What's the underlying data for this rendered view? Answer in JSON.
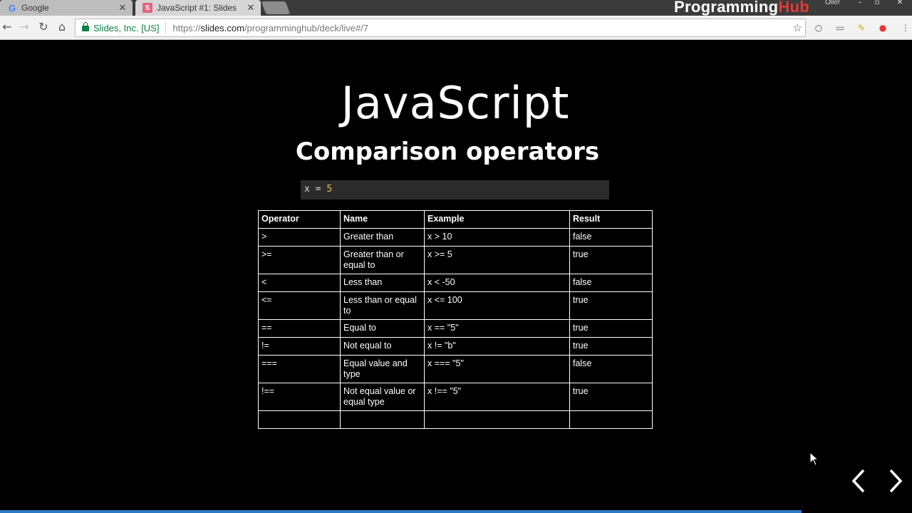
{
  "browser": {
    "tabs": [
      {
        "label": "Google",
        "favicon": "google-icon"
      },
      {
        "label": "JavaScript #1: Slides",
        "favicon": "slides-icon"
      }
    ],
    "brand": {
      "part1": "Programming",
      "part2": "Hub"
    },
    "user_label": "Oller",
    "security_label": "Slides, Inc. [US]",
    "url": {
      "prefix": "https://",
      "host": "slides.com",
      "path": "/programminghub/deck/live#/7"
    }
  },
  "slide": {
    "title": "JavaScript",
    "subtitle": "Comparison operators",
    "code": {
      "var": "x",
      "op": "=",
      "value": "5"
    },
    "table": {
      "headers": [
        "Operator",
        "Name",
        "Example",
        "Result"
      ],
      "rows": [
        [
          ">",
          "Greater than",
          "x > 10",
          "false"
        ],
        [
          ">=",
          "Greater than or equal to",
          "x >= 5",
          "true"
        ],
        [
          "<",
          "Less than",
          "x < -50",
          "false"
        ],
        [
          "<=",
          "Less than or equal to",
          "x <= 100",
          "true"
        ],
        [
          "==",
          "Equal to",
          "x == \"5\"",
          "true"
        ],
        [
          "!=",
          "Not equal to",
          "x != \"b\"",
          "true"
        ],
        [
          "===",
          "Equal value and type",
          "x === \"5\"",
          "false"
        ],
        [
          "!==",
          "Not equal value or equal type",
          "x !== \"5\"",
          "true"
        ],
        [
          "",
          "",
          "",
          ""
        ]
      ]
    }
  },
  "colors": {
    "background": "#000000",
    "progress": "#2a78c4",
    "brand_accent": "#e53935",
    "secure_green": "#0b8043"
  }
}
